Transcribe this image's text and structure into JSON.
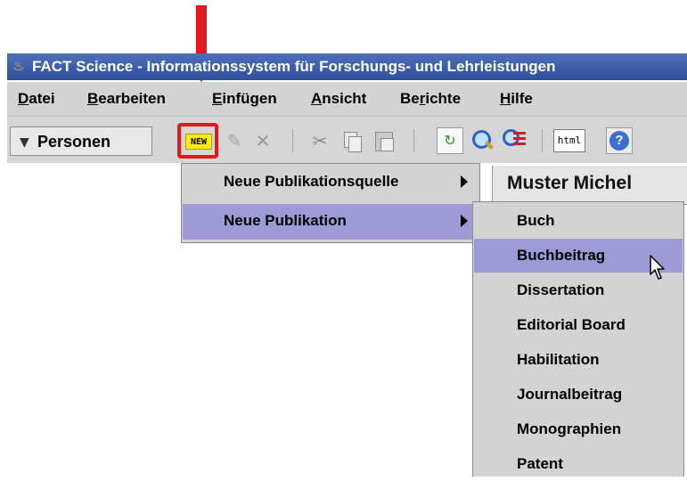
{
  "window": {
    "title": "FACT Science - Informationssystem für Forschungs- und Lehrleistungen"
  },
  "menubar": {
    "items": [
      {
        "label_pre": "",
        "label_ul": "D",
        "label_post": "atei"
      },
      {
        "label_pre": "",
        "label_ul": "B",
        "label_post": "earbeiten"
      },
      {
        "label_pre": "",
        "label_ul": "E",
        "label_post": "infügen"
      },
      {
        "label_pre": "",
        "label_ul": "A",
        "label_post": "nsicht"
      },
      {
        "label_pre": "Be",
        "label_ul": "r",
        "label_post": "ichte"
      },
      {
        "label_pre": "",
        "label_ul": "H",
        "label_post": "ilfe"
      }
    ]
  },
  "toolbar": {
    "module_label": "Personen",
    "new_label": "NEW",
    "html_label": "html",
    "icons": [
      "new-icon",
      "edit-icon",
      "delete-icon",
      "cut-icon",
      "copy-icon",
      "paste-icon",
      "refresh-icon",
      "search-icon",
      "search-list-icon",
      "html-icon",
      "help-icon"
    ]
  },
  "person_panel": {
    "name": "Muster Michel"
  },
  "context_menu": {
    "items": [
      {
        "label": "Neue Publikationsquelle",
        "has_submenu": true,
        "selected": false
      },
      {
        "label": "Neue Publikation",
        "has_submenu": true,
        "selected": true
      }
    ],
    "submenu": [
      {
        "label": "Buch",
        "selected": false
      },
      {
        "label": "Buchbeitrag",
        "selected": true
      },
      {
        "label": "Dissertation",
        "selected": false
      },
      {
        "label": "Editorial Board",
        "selected": false
      },
      {
        "label": "Habilitation",
        "selected": false
      },
      {
        "label": "Journalbeitrag",
        "selected": false
      },
      {
        "label": "Monographien",
        "selected": false
      },
      {
        "label": "Patent",
        "selected": false
      }
    ]
  },
  "colors": {
    "annotation": "#e0191b",
    "titlebar": "#3a5aa8",
    "menu_bg": "#d3d3d3",
    "selection": "#9c9bd6"
  }
}
